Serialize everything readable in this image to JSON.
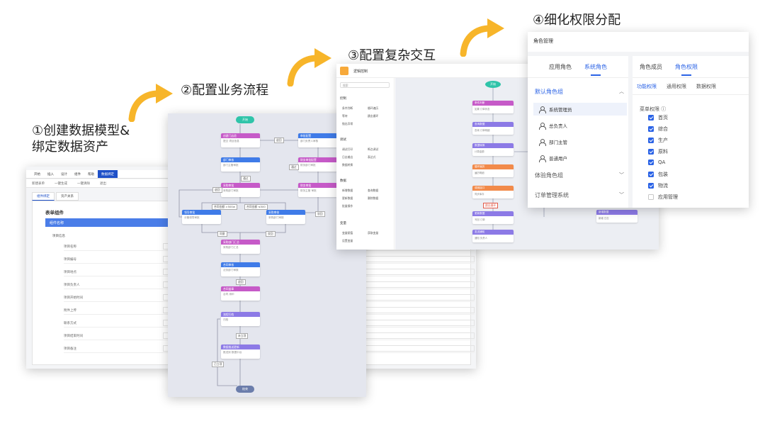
{
  "steps": [
    {
      "title": "①创建数据模型&"
    },
    {
      "title": "绑定数据资产"
    },
    {
      "title": "②配置业务流程"
    },
    {
      "title": "③配置复杂交互"
    },
    {
      "title": "④细化权限分配"
    }
  ],
  "panel1": {
    "menu": [
      "开始",
      "插入",
      "设计",
      "组件",
      "帮助",
      "数据绑定"
    ],
    "toolbar": [
      "新建表单",
      "一键生成",
      "一键清除",
      "退出"
    ],
    "tabs": [
      "组件绑定",
      "资产关系"
    ],
    "form_title": "表单组件",
    "form_head": "组件名称",
    "group": "项目信息",
    "fields": [
      "项目名称",
      "项目编号",
      "项目地点",
      "项目负责人",
      "项目开始时间",
      "附件上传",
      "联系方式",
      "项目结束时间",
      "项目备注"
    ]
  },
  "panel2": {
    "start": "开始",
    "end": "结束",
    "nodes": [
      {
        "title": "创建门店验",
        "body": "提交 项目信息"
      },
      {
        "title": "审批配置",
        "body": "部门负责人审核"
      },
      {
        "title": "部门审核",
        "body": "部门主管审批"
      },
      {
        "title": "财务审批配置",
        "body": "财务部门审批"
      },
      {
        "title": "采购审批",
        "body": "采购部门审批"
      },
      {
        "title": "财务审批",
        "body": "财务主管 审批"
      },
      {
        "title": "领导审批",
        "body": "分管领导审批"
      },
      {
        "title": "采购审核",
        "body": "采购部门审核"
      },
      {
        "title": "采购部门汇总",
        "body": "采购部门汇总"
      },
      {
        "title": "合同审核",
        "body": "法务部门审核"
      },
      {
        "title": "合同盖章",
        "body": "合同 用印"
      },
      {
        "title": "流程归档",
        "body": "归档"
      },
      {
        "title": "数据推送更新",
        "body": "推送到 数据中台"
      }
    ],
    "conditions": [
      "退回",
      "通过",
      "退回",
      "通过",
      "合同金额 >500w",
      "合同金额 ≤500",
      "驳回",
      "同意",
      "驳回",
      "退回",
      "未立项",
      "已立项"
    ]
  },
  "panel3": {
    "title": "逻辑控制",
    "header_right": "订单",
    "search": "搜索",
    "categories": [
      "控制",
      "调试",
      "数据",
      "变量"
    ],
    "items": [
      "条件判断",
      "循环遍历",
      "等待",
      "跳出循环",
      "抛出异常",
      "调试打印",
      "断点调试",
      "日志输出",
      "表达式",
      "数据转换",
      "新增数据",
      "查询数据",
      "更新数据",
      "删除数据",
      "批量操作",
      "变量赋值",
      "获取变量",
      "设置变量"
    ],
    "start": "开始",
    "nodes": [
      {
        "title": "条件判断",
        "body": "如果 订单状态"
      },
      {
        "title": "查询数据",
        "body": "查询 订单明细"
      },
      {
        "title": "数据转换",
        "body": "计算金额"
      },
      {
        "title": "循环遍历",
        "body": "遍历明细"
      },
      {
        "title": "调用接口",
        "body": "同步库存"
      },
      {
        "title": "更新数据",
        "body": "写回 订单"
      },
      {
        "title": "发送通知",
        "body": "通知 负责人"
      },
      {
        "title": "变量赋值",
        "body": "设置结果"
      }
    ],
    "badge": "跳出循环",
    "side_node": {
      "title": "新增数据",
      "body": "新增 日志"
    }
  },
  "panel4": {
    "title": "角色管理",
    "left_tabs": [
      "应用角色",
      "系统角色"
    ],
    "right_tabs": [
      "角色成员",
      "角色权限"
    ],
    "groups": [
      "默认角色组",
      "体验角色组",
      "订单管理系统"
    ],
    "roles": [
      "系统管理员",
      "总负责人",
      "部门主管",
      "普通用户"
    ],
    "sub_tabs": [
      "功能权限",
      "通用权限",
      "数据权限"
    ],
    "menu_perm_label": "菜单权限 ⓘ",
    "perms": [
      {
        "name": "首页",
        "checked": true
      },
      {
        "name": "综合",
        "checked": true
      },
      {
        "name": "生产",
        "checked": true
      },
      {
        "name": "原料",
        "checked": true
      },
      {
        "name": "QA",
        "checked": true
      },
      {
        "name": "包装",
        "checked": true
      },
      {
        "name": "物流",
        "checked": true
      },
      {
        "name": "应用管理",
        "checked": false
      }
    ],
    "accent": "#2b63e6"
  },
  "colors": {
    "arrow": "#f7b52a",
    "purple": "#c65ac8",
    "blue": "#3f7be8",
    "orange": "#f28a4a",
    "violet": "#8c7ae6",
    "teal": "#2fc4a9"
  }
}
